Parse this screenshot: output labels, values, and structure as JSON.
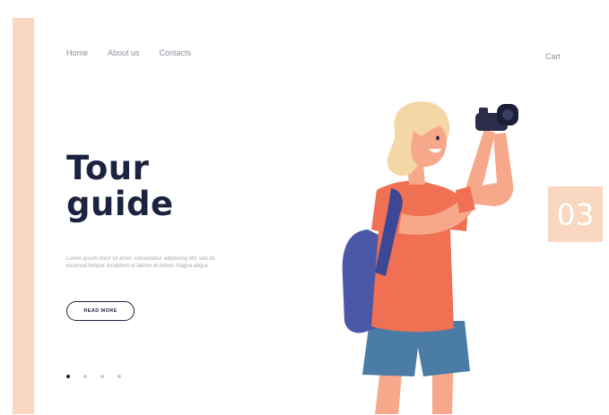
{
  "nav": {
    "items": [
      {
        "label": "Home"
      },
      {
        "label": "About us"
      },
      {
        "label": "Contacts"
      }
    ],
    "cart_label": "Cart"
  },
  "hero": {
    "title_line1": "Tour",
    "title_line2": "guide",
    "body": "Lorem ipsum dolor sit amet, consectetur adipiscing elit, sed do eiusmod tempor incididunt ut labore et dolore magna aliqua.",
    "button_label": "READ MORE"
  },
  "slider": {
    "dots": 4,
    "active_index": 0,
    "page_number": "03"
  },
  "illustration": {
    "subject": "tourist-with-camera",
    "icon": "camera-icon"
  },
  "colors": {
    "accent": "#f9d7c0",
    "title": "#1c2340",
    "shirt": "#ef7052",
    "backpack": "#4b58a8",
    "shorts": "#4a7ca6",
    "skin": "#f7a88a",
    "hair": "#f4d7a6",
    "camera": "#2b2d4a"
  }
}
